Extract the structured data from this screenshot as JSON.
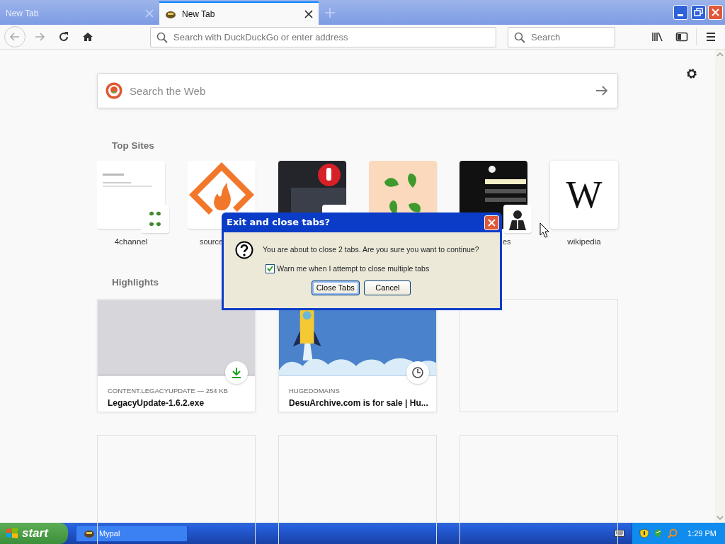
{
  "tabs": [
    {
      "label": "New Tab",
      "selected": false
    },
    {
      "label": "New Tab",
      "selected": true
    }
  ],
  "toolbar": {
    "address_placeholder": "Search with DuckDuckGo or enter address",
    "search_placeholder": "Search"
  },
  "page": {
    "search_placeholder": "Search the Web",
    "top_sites_heading": "Top Sites",
    "top_sites": [
      {
        "label": "4channel",
        "kind": "screenshot",
        "clipped_right": false,
        "clipped_left": false
      },
      {
        "label": "source",
        "kind": "flame",
        "clipped_right": true,
        "clipped_left": false
      },
      {
        "kind": "dark-hand"
      },
      {
        "kind": "clover"
      },
      {
        "label": "es",
        "kind": "dark-page",
        "clipped_right": false,
        "clipped_left": true
      },
      {
        "label": "wikipedia",
        "kind": "letter",
        "glyph": "W",
        "clipped_right": false,
        "clipped_left": false
      }
    ],
    "highlights_heading": "Highlights",
    "highlights": [
      {
        "kind": "download",
        "source": "CONTENT.LEGACYUPDATE — 254 KB",
        "title": "LegacyUpdate-1.6.2.exe"
      },
      {
        "kind": "visited",
        "source": "HUGEDOMAINS",
        "title": "DesuArchive.com is for sale | Hu..."
      },
      {
        "kind": "empty"
      },
      {
        "kind": "empty"
      },
      {
        "kind": "empty"
      },
      {
        "kind": "empty"
      }
    ]
  },
  "dialog": {
    "title": "Exit and close tabs?",
    "message": "You are about to close 2 tabs. Are you sure you want to continue?",
    "checkbox": {
      "label": "Warn me when I attempt to close multiple tabs",
      "checked": true
    },
    "buttons": [
      {
        "label": "Close Tabs",
        "default": true
      },
      {
        "label": "Cancel",
        "default": false
      }
    ]
  },
  "taskbar": {
    "start": "start",
    "windows": [
      {
        "label": "Mypal",
        "selected": false
      }
    ],
    "clock": "1:29 PM"
  }
}
